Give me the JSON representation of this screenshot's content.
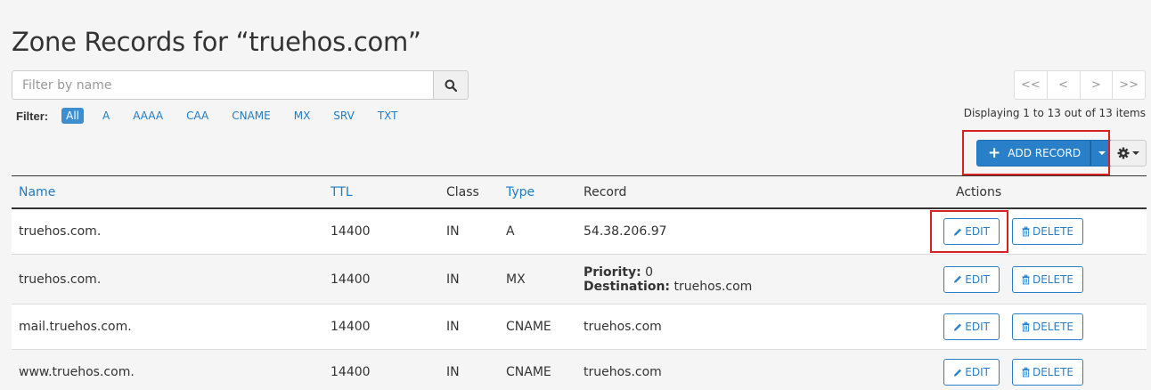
{
  "page": {
    "title": "Zone Records for “truehos.com”"
  },
  "search": {
    "placeholder": "Filter by name",
    "icon": "search-icon"
  },
  "filter": {
    "label": "Filter:",
    "items": [
      "All",
      "A",
      "AAAA",
      "CAA",
      "CNAME",
      "MX",
      "SRV",
      "TXT"
    ],
    "active": "All"
  },
  "pager": {
    "first": "<<",
    "prev": "<",
    "next": ">",
    "last": ">>"
  },
  "displaying": "Displaying 1 to 13 out of 13 items",
  "toolbar": {
    "add_label": "ADD RECORD",
    "gear_icon": "gear-icon"
  },
  "table": {
    "headers": {
      "name": "Name",
      "ttl": "TTL",
      "class": "Class",
      "type": "Type",
      "record": "Record",
      "actions": "Actions"
    },
    "rows": [
      {
        "name": "truehos.com.",
        "ttl": "14400",
        "class": "IN",
        "type": "A",
        "record": "54.38.206.97"
      },
      {
        "name": "truehos.com.",
        "ttl": "14400",
        "class": "IN",
        "type": "MX",
        "priority_label": "Priority:",
        "priority": "0",
        "destination_label": "Destination:",
        "destination": "truehos.com"
      },
      {
        "name": "mail.truehos.com.",
        "ttl": "14400",
        "class": "IN",
        "type": "CNAME",
        "record": "truehos.com"
      },
      {
        "name": "www.truehos.com.",
        "ttl": "14400",
        "class": "IN",
        "type": "CNAME",
        "record": "truehos.com"
      }
    ],
    "edit_label": "EDIT",
    "delete_label": "DELETE"
  },
  "colors": {
    "accent": "#2a80c8",
    "link": "#1f7cc2",
    "highlight": "#d62222"
  }
}
